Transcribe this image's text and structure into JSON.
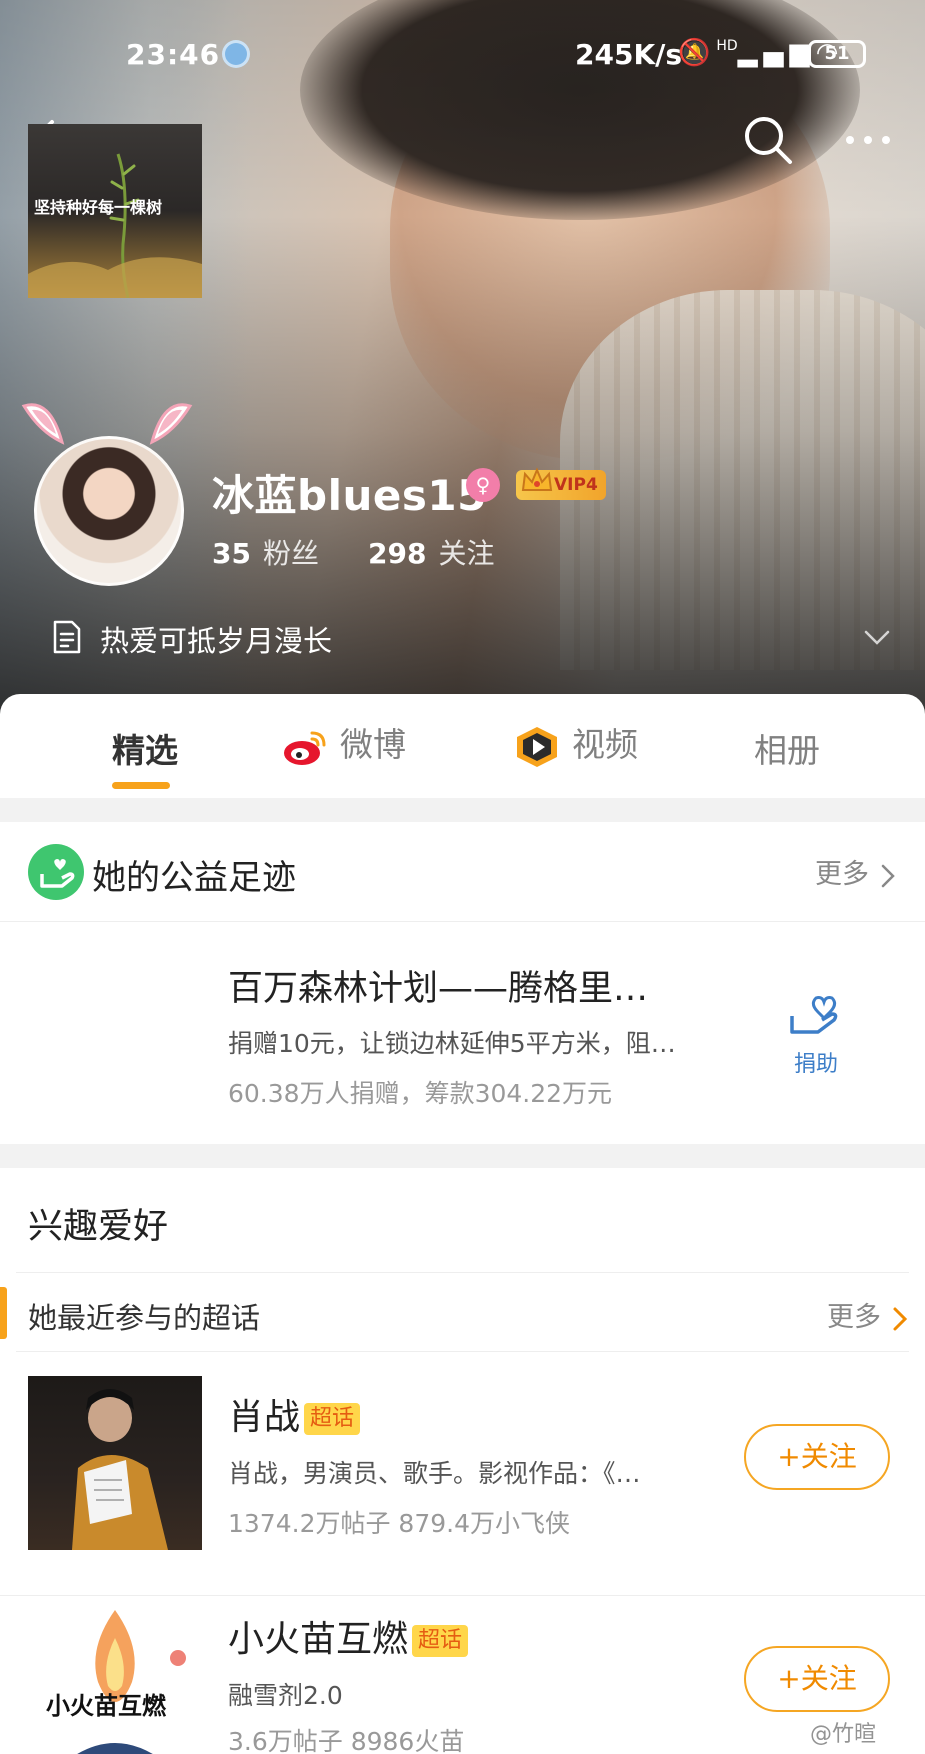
{
  "status_bar": {
    "time": "23:46",
    "net_speed": "245K/s",
    "signal_label": "HD",
    "battery": "51"
  },
  "profile": {
    "username": "冰蓝blues15",
    "gender_symbol": "♀",
    "vip_label": "VIP4",
    "followers_count": "35",
    "followers_label": "粉丝",
    "following_count": "298",
    "following_label": "关注",
    "bio": "热爱可抵岁月漫长"
  },
  "tabs": [
    {
      "label": "精选",
      "active": true
    },
    {
      "label": "微博",
      "icon": "weibo-logo-icon"
    },
    {
      "label": "视频",
      "icon": "video-play-icon"
    },
    {
      "label": "相册"
    }
  ],
  "charity": {
    "title": "她的公益足迹",
    "more_label": "更多",
    "project": {
      "thumb_caption": "坚持种好每一棵树",
      "title": "百万森林计划——腾格里…",
      "description": "捐赠10元，让锁边林延伸5平方米，阻…",
      "stats": "60.38万人捐赠，筹款304.22万元",
      "donate_label": "捐助"
    }
  },
  "interests": {
    "title": "兴趣爱好",
    "supertopic_label": "她最近参与的超话",
    "more_label": "更多",
    "topics": [
      {
        "name": "肖战",
        "tag": "超话",
        "description": "肖战，男演员、歌手。影视作品：《…",
        "stats": "1374.2万帖子 879.4万小飞侠",
        "follow_label": "+关注"
      },
      {
        "name": "小火苗互燃",
        "tag": "超话",
        "description": "融雪剂2.0",
        "stats": "3.6万帖子 8986火苗",
        "follow_label": "+关注",
        "thumb_text": "小火苗互燃"
      }
    ]
  },
  "watermark": "@竹暄",
  "colors": {
    "accent_orange": "#f7a21b",
    "follow_orange": "#f08a00",
    "donate_blue": "#3d7ec8",
    "charity_green": "#3fc66f",
    "supertopic_tag_bg": "#ffd64a"
  }
}
